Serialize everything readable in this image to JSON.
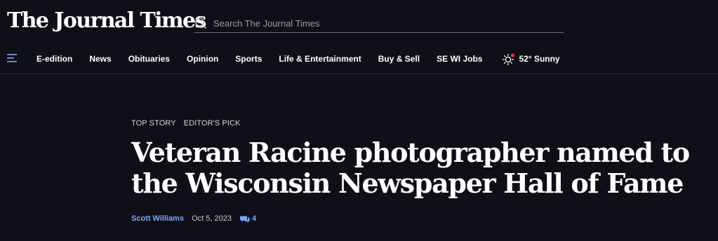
{
  "site": {
    "logo_text": "The Journal Times"
  },
  "search": {
    "placeholder": "Search The Journal Times",
    "value": ""
  },
  "nav": {
    "menu_icon": "hamburger-menu-icon",
    "items": [
      {
        "label": "E-edition"
      },
      {
        "label": "News"
      },
      {
        "label": "Obituaries"
      },
      {
        "label": "Opinion"
      },
      {
        "label": "Sports"
      },
      {
        "label": "Life & Entertainment"
      },
      {
        "label": "Buy & Sell"
      },
      {
        "label": "SE WI Jobs"
      }
    ],
    "weather": {
      "icon": "sun-icon",
      "text": "52° Sunny"
    }
  },
  "article": {
    "tags": [
      "TOP STORY",
      "EDITOR'S PICK"
    ],
    "headline": "Veteran Racine photographer named to the Wisconsin Newspaper Hall of Fame",
    "author": "Scott Williams",
    "date": "Oct 5, 2023",
    "comment_count": "4"
  },
  "colors": {
    "background": "#0f1017",
    "accent_link": "#7ea6ff",
    "weather_dot": "#e0343b",
    "text": "#ffffff"
  }
}
